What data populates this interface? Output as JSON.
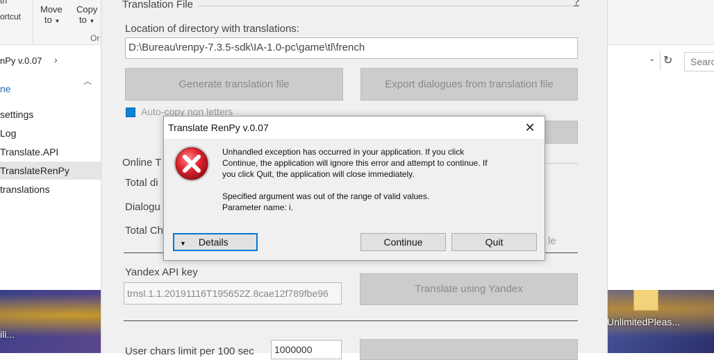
{
  "explorer": {
    "ribbon": {
      "shortcut_partial": "ortcut",
      "top_partial": "th",
      "move_label": "Move",
      "move_sub": "to",
      "copy_label": "Copy",
      "copy_sub": "to",
      "organize_partial": "Or"
    },
    "address_partial": "nPy v.0.07",
    "search_placeholder": "Searc",
    "nav_items": [
      {
        "label": "ne"
      },
      {
        "label": "settings"
      },
      {
        "label": "Log"
      },
      {
        "label": "Translate.API"
      },
      {
        "label": "TranslateRenPy"
      },
      {
        "label": "translations"
      }
    ],
    "desktop_icon_label": "UnlimitedPleas...",
    "desktop_left_label": "ili..."
  },
  "app": {
    "group_title": "Translation File",
    "help_mark": "?",
    "location_label": "Location of directory with translations:",
    "location_value": "D:\\Bureau\\renpy-7.3.5-sdk\\IA-1.0-pc\\game\\tl\\french",
    "generate_button": "Generate translation file",
    "export_button": "Export dialogues from translation file",
    "autocopy_label": "Auto-copy non letters",
    "online_partial": "Online T",
    "total_d_partial": "Total di",
    "dialogu_partial": "Dialogu",
    "total_c_partial": "Total Ch",
    "le_partial": "le",
    "yandex_label": "Yandex API key",
    "yandex_value": "trnsl.1.1.20191116T195652Z.8cae12f789fbe96",
    "translate_yandex_button": "Translate using Yandex",
    "char_limit_partial": "User chars limit per 100 sec",
    "char_limit_value": "1000000"
  },
  "dialog": {
    "title": "Translate RenPy  v.0.07",
    "message_lines": [
      "Unhandled exception has occurred in your application. If you click",
      "Continue, the application will ignore this error and attempt to continue. If",
      "you click Quit, the application will close immediately."
    ],
    "detail_lines": [
      "Specified argument was out of the range of valid values.",
      "Parameter name: i."
    ],
    "details_button": "Details",
    "continue_button": "Continue",
    "quit_button": "Quit",
    "error_icon": "error-x-icon",
    "close_glyph": "✕"
  },
  "colors": {
    "error_red": "#d7263d",
    "focus_blue": "#0078d7",
    "checkbox_blue": "#0a84d6"
  }
}
